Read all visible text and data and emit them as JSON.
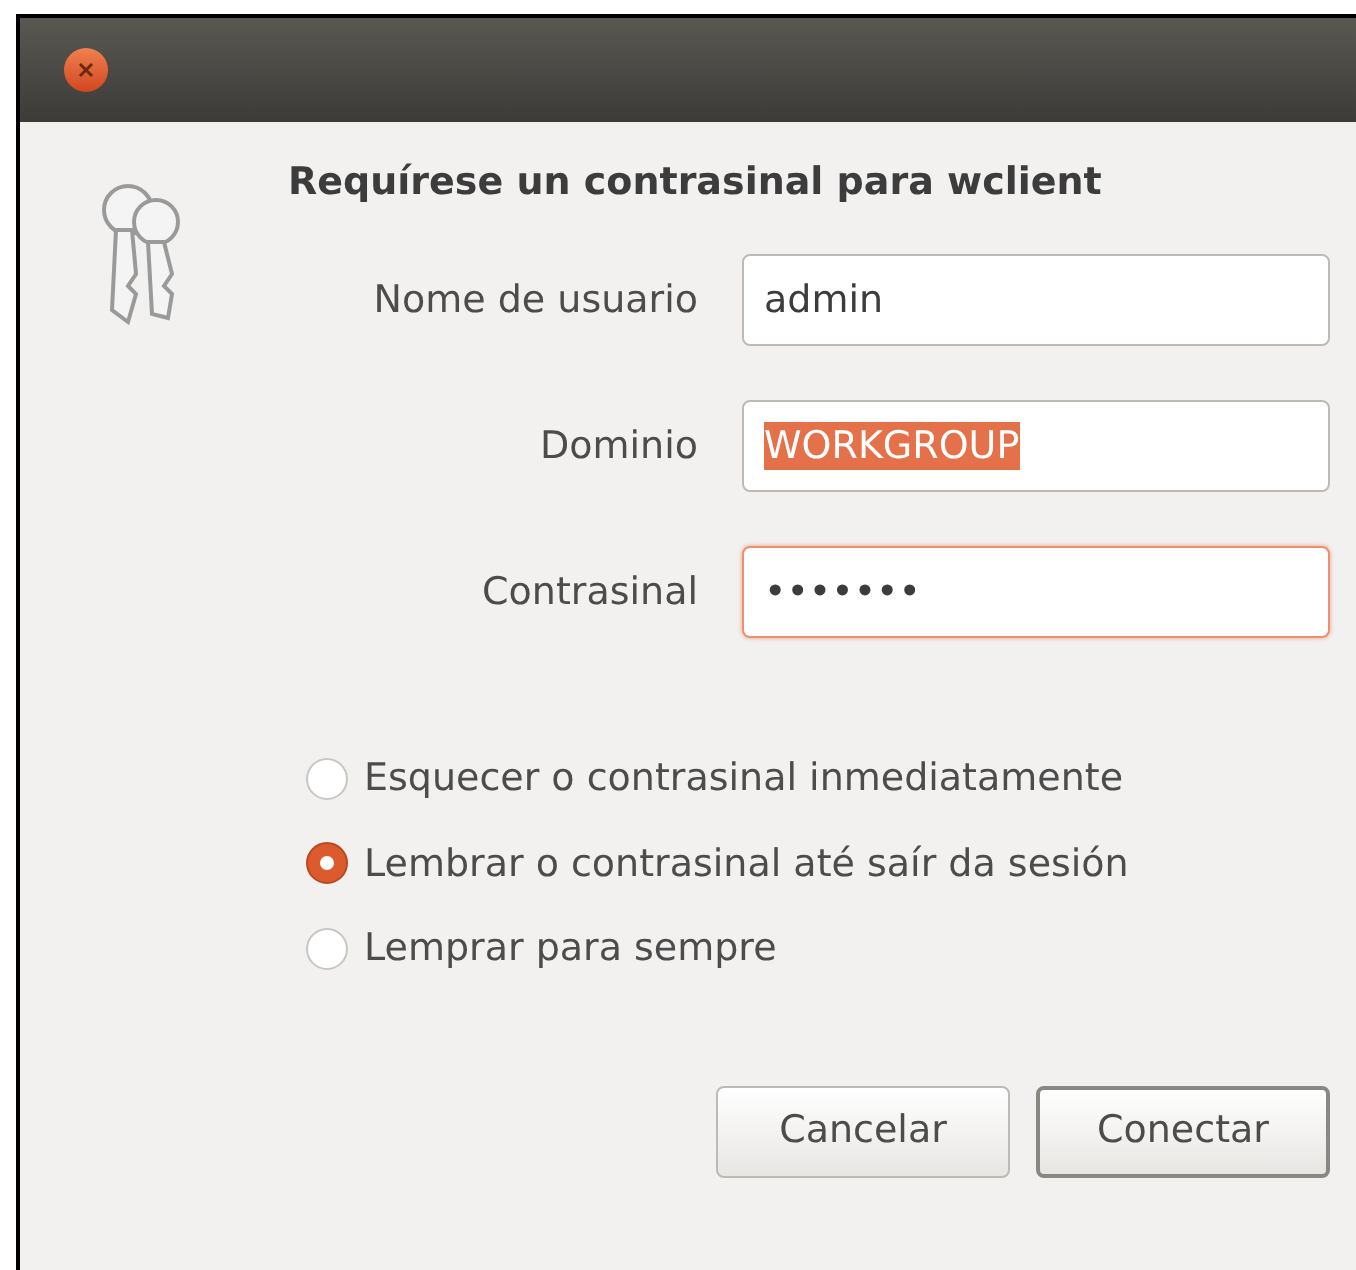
{
  "window": {
    "heading": "Requírese un contrasinal para wclient"
  },
  "fields": [
    {
      "label": "Nome de usuario",
      "value": "admin",
      "text_selected": false,
      "focused": false
    },
    {
      "label": "Dominio",
      "value": "WORKGROUP",
      "text_selected": true,
      "focused": false
    },
    {
      "label": "Contrasinal",
      "value": "•••••••",
      "text_selected": false,
      "focused": true
    }
  ],
  "options": [
    {
      "label": "Esquecer o contrasinal inmediatamente",
      "selected": false
    },
    {
      "label": "Lembrar o contrasinal até saír da sesión",
      "selected": true
    },
    {
      "label": "Lemprar para sempre",
      "selected": false
    }
  ],
  "buttons": [
    {
      "label": "Cancelar",
      "default": false
    },
    {
      "label": "Conectar",
      "default": true
    }
  ]
}
